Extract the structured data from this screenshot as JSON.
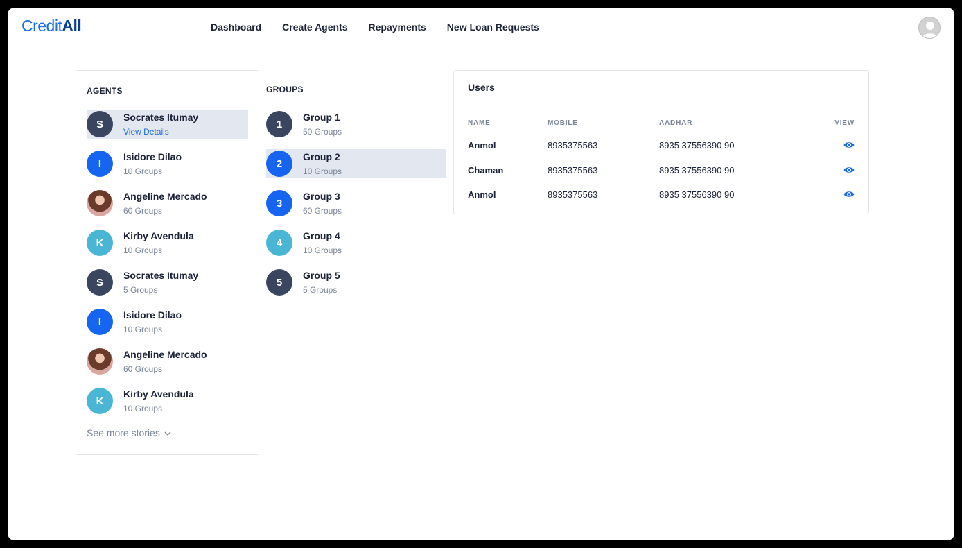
{
  "header": {
    "logo_part1": "Credit",
    "logo_part2": "All",
    "nav": [
      "Dashboard",
      "Create Agents",
      "Repayments",
      "New Loan Requests"
    ]
  },
  "agents": {
    "title": "AGENTS",
    "items": [
      {
        "initial": "S",
        "name": "Socrates Itumay",
        "sub": "View Details",
        "color": "#3a4660",
        "selected": true,
        "photo": false
      },
      {
        "initial": "I",
        "name": "Isidore Dilao",
        "sub": "10 Groups",
        "color": "#1565f0",
        "selected": false,
        "photo": false
      },
      {
        "initial": "",
        "name": "Angeline Mercado",
        "sub": "60 Groups",
        "color": "#b7766a",
        "selected": false,
        "photo": true
      },
      {
        "initial": "K",
        "name": "Kirby Avendula",
        "sub": "10 Groups",
        "color": "#4ab6d6",
        "selected": false,
        "photo": false
      },
      {
        "initial": "S",
        "name": "Socrates Itumay",
        "sub": "5 Groups",
        "color": "#3a4660",
        "selected": false,
        "photo": false
      },
      {
        "initial": "I",
        "name": "Isidore Dilao",
        "sub": "10 Groups",
        "color": "#1565f0",
        "selected": false,
        "photo": false
      },
      {
        "initial": "",
        "name": "Angeline Mercado",
        "sub": "60 Groups",
        "color": "#b7766a",
        "selected": false,
        "photo": true
      },
      {
        "initial": "K",
        "name": "Kirby Avendula",
        "sub": "10 Groups",
        "color": "#4ab6d6",
        "selected": false,
        "photo": false
      }
    ],
    "see_more": "See more stories"
  },
  "groups": {
    "title": "GROUPS",
    "items": [
      {
        "initial": "1",
        "name": "Group 1",
        "sub": "50 Groups",
        "color": "#3a4660",
        "selected": false
      },
      {
        "initial": "2",
        "name": "Group 2",
        "sub": "10 Groups",
        "color": "#1565f0",
        "selected": true
      },
      {
        "initial": "3",
        "name": "Group 3",
        "sub": "60 Groups",
        "color": "#1565f0",
        "selected": false
      },
      {
        "initial": "4",
        "name": "Group 4",
        "sub": "10 Groups",
        "color": "#4ab6d6",
        "selected": false
      },
      {
        "initial": "5",
        "name": "Group 5",
        "sub": "5 Groups",
        "color": "#3a4660",
        "selected": false
      }
    ]
  },
  "users": {
    "title": "Users",
    "columns": [
      "NAME",
      "MOBILE",
      "AADHAR",
      "VIEW"
    ],
    "rows": [
      {
        "name": "Anmol",
        "mobile": "8935375563",
        "aadhar": "8935 37556390 90"
      },
      {
        "name": "Chaman",
        "mobile": "8935375563",
        "aadhar": "8935 37556390 90"
      },
      {
        "name": "Anmol",
        "mobile": "8935375563",
        "aadhar": "8935 37556390 90"
      }
    ]
  },
  "colors": {
    "accent": "#1a6ce8",
    "brand_dark": "#0b3d91",
    "selected_bg": "#e3e7ef"
  }
}
